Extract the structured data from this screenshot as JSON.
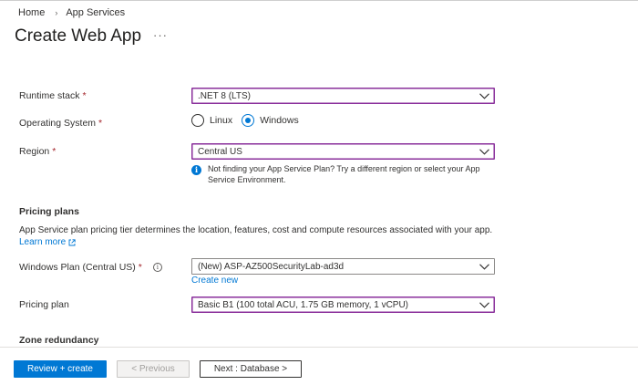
{
  "breadcrumb": {
    "home": "Home",
    "separator": "›",
    "current": "App Services"
  },
  "page": {
    "title": "Create Web App",
    "more": "···"
  },
  "form": {
    "runtime_stack": {
      "label": "Runtime stack",
      "required": "*",
      "value": ".NET 8 (LTS)"
    },
    "operating_system": {
      "label": "Operating System",
      "required": "*",
      "options": [
        "Linux",
        "Windows"
      ],
      "selected": "Windows"
    },
    "region": {
      "label": "Region",
      "required": "*",
      "value": "Central US",
      "info_line1": "Not finding your App Service Plan? Try a different region or select your App",
      "info_line2": "Service Environment."
    }
  },
  "pricing": {
    "title": "Pricing plans",
    "description": "App Service plan pricing tier determines the location, features, cost and compute resources associated with your app.",
    "learn_more": "Learn more",
    "windows_plan": {
      "label": "Windows Plan (Central US)",
      "required": "*",
      "value": "(New) ASP-AZ500SecurityLab-ad3d",
      "create_new": "Create new"
    },
    "pricing_plan": {
      "label": "Pricing plan",
      "value": "Basic B1 (100 total ACU, 1.75 GB memory, 1 vCPU)"
    }
  },
  "zone": {
    "title": "Zone redundancy"
  },
  "footer": {
    "review_create": "Review + create",
    "previous": "< Previous",
    "next": "Next : Database >"
  },
  "colors": {
    "accent": "#0078d4",
    "focus_border": "#8a2f9b",
    "required": "#a4262c"
  }
}
